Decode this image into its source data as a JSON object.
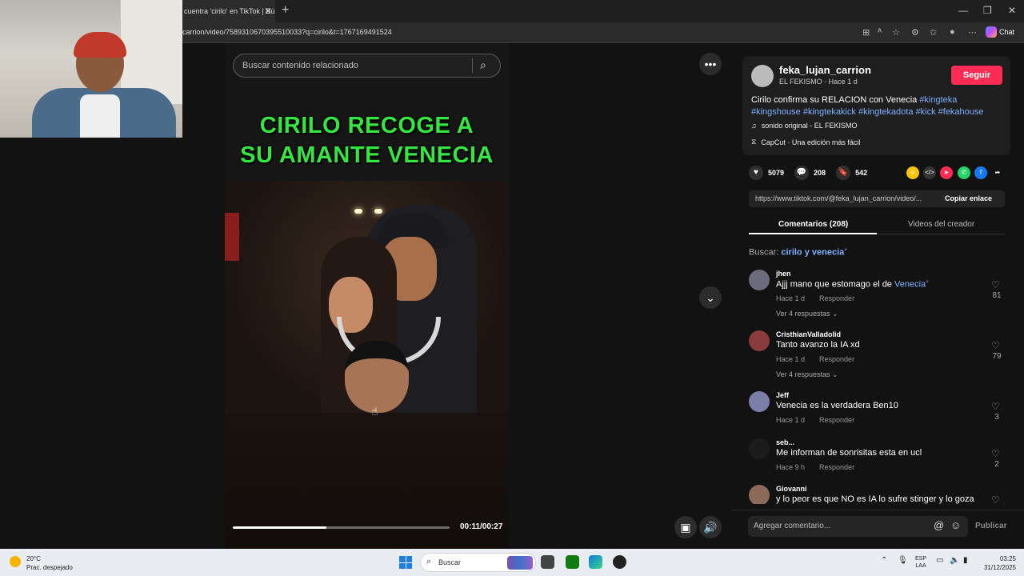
{
  "browser": {
    "tab_title": "cuentra 'cirilo' en TikTok | Bú",
    "url": "carrion/video/7589310670395510033?q=cirilo&t=1767169491524",
    "chat_label": "Chat"
  },
  "video": {
    "search_placeholder": "Buscar contenido relacionado",
    "headline_line1": "CIRILO RECOGE A",
    "headline_line2": "SU AMANTE VENECIA",
    "time": "00:11/00:27",
    "progress": 0.43
  },
  "author": {
    "username": "feka_lujan_carrion",
    "subtitle": "EL FEKISMO · Hace 1 d",
    "follow_label": "Seguir"
  },
  "description": {
    "text": "Cirilo confirma su RELACION con Venecia ",
    "hashtags": [
      "#kingteka",
      "#kingshouse",
      "#kingtekakick",
      "#kingtekadota",
      "#kick",
      "#fekahouse"
    ],
    "sound": "sonido original - EL FEKISMO",
    "capcut": "CapCut · Una edición más fácil"
  },
  "stats": {
    "likes": "5079",
    "comments": "208",
    "saves": "542"
  },
  "link": {
    "url": "https://www.tiktok.com/@feka_lujan_carrion/video/...",
    "copy_label": "Copiar enlace"
  },
  "tabs": {
    "comments": "Comentarios (208)",
    "creator_videos": "Videos del creador"
  },
  "search_suggestion": {
    "label": "Buscar:",
    "query": "cirilo y venecia"
  },
  "comments": [
    {
      "user": "jhen",
      "text": "Ajjj mano que estomago el de ",
      "link": "Venecia",
      "time": "Hace 1 d",
      "reply": "Responder",
      "more": "Ver 4 respuestas",
      "likes": "81"
    },
    {
      "user": "CristhianValladolid",
      "text": "Tanto avanzo la IA xd",
      "time": "Hace 1 d",
      "reply": "Responder",
      "more": "Ver 4 respuestas",
      "likes": "79"
    },
    {
      "user": "Jeff",
      "text": "Venecia es la verdadera Ben10",
      "time": "Hace 1 d",
      "reply": "Responder",
      "likes": "3"
    },
    {
      "user": "seb...",
      "text": "Me informan de sonrisitas esta en ucl",
      "time": "Hace 9 h",
      "reply": "Responder",
      "likes": "2"
    },
    {
      "user": "Giovanni",
      "text": "y lo peor es que NO es IA lo sufre stinger y lo goza"
    }
  ],
  "comment_input": {
    "placeholder": "Agregar comentario...",
    "publish_label": "Publicar"
  },
  "taskbar": {
    "temp": "20°C",
    "weather": "Prac. despejado",
    "search_label": "Buscar",
    "lang1": "ESP",
    "lang2": "LAA",
    "time": "03:25",
    "date": "31/12/2025"
  }
}
